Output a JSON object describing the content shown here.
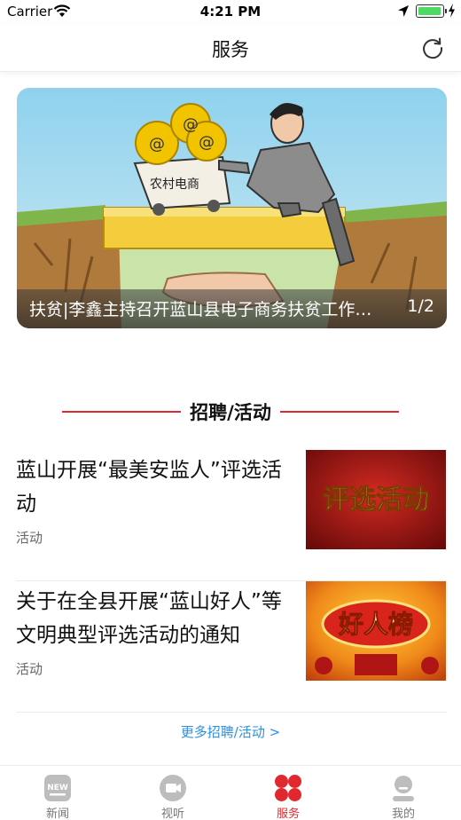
{
  "status_bar": {
    "carrier": "Carrier",
    "time": "4:21 PM",
    "battery_level": 0.85,
    "battery_color": "#4cd964"
  },
  "nav": {
    "title": "服务",
    "refresh_icon": "refresh-icon"
  },
  "banner": {
    "title": "扶贫|李鑫主持召开蓝山县电子商务扶贫工作会议",
    "page_indicator": "1/2",
    "cart_text": "农村电商"
  },
  "section": {
    "title": "招聘/活动",
    "accent_color": "#e0282e"
  },
  "articles": [
    {
      "title": "蓝山开展“最美安监人”评选活动",
      "tag": "活动",
      "thumb_text": "评选活动"
    },
    {
      "title": "关于在全县开展“蓝山好人”等文明典型评选活动的通知",
      "tag": "活动",
      "thumb_text": "好人榜"
    }
  ],
  "more_link": "更多招聘/活动 >",
  "more_link_color": "#2f8fe0",
  "tabs": [
    {
      "label": "新闻",
      "icon": "news-icon",
      "active": false
    },
    {
      "label": "视听",
      "icon": "video-icon",
      "active": false
    },
    {
      "label": "服务",
      "icon": "service-icon",
      "active": true
    },
    {
      "label": "我的",
      "icon": "profile-icon",
      "active": false
    }
  ]
}
